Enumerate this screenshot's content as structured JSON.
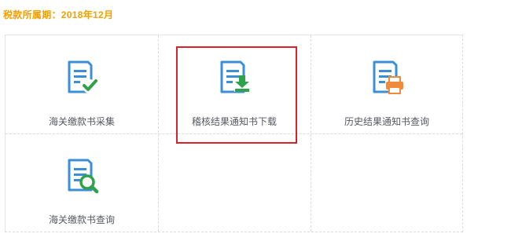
{
  "period_label": "税款所属期：2018年12月",
  "tiles": [
    {
      "label": "海关缴款书采集",
      "icon": "document-check-icon"
    },
    {
      "label": "稽核结果通知书下载",
      "icon": "document-download-icon"
    },
    {
      "label": "历史结果通知书查询",
      "icon": "document-print-icon"
    },
    {
      "label": "海关缴款书查询",
      "icon": "document-search-icon"
    }
  ],
  "colors": {
    "period_text": "#f0a000",
    "icon_blue": "#3a8fd6",
    "icon_green": "#2fa24a",
    "icon_orange": "#f08a3c",
    "highlight_border": "#d7222a"
  }
}
